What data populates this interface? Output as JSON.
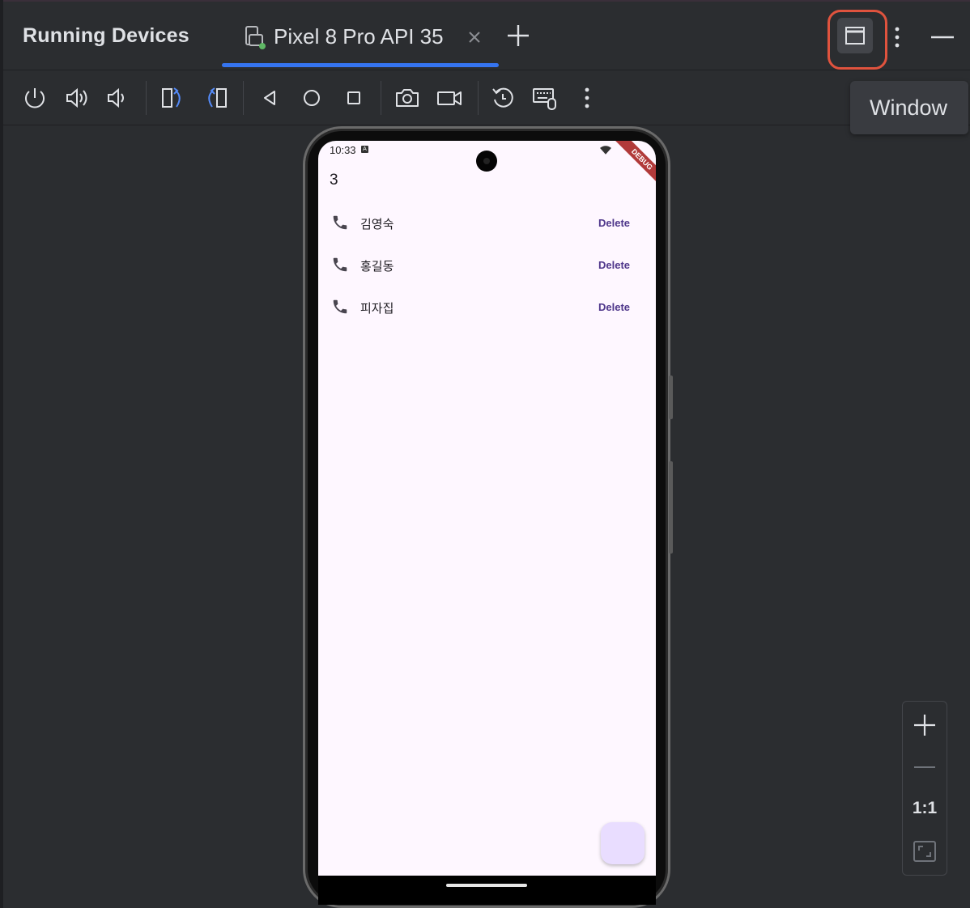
{
  "header": {
    "title": "Running Devices",
    "tab": {
      "label": "Pixel 8 Pro API 35"
    }
  },
  "tooltip": {
    "text": "Window"
  },
  "toolbar": {
    "icons": [
      "power-icon",
      "volume-up-icon",
      "volume-down-icon",
      "rotate-left-icon",
      "rotate-right-icon",
      "back-icon",
      "home-icon",
      "overview-icon",
      "screenshot-icon",
      "screen-record-icon",
      "reset-icon",
      "keyboard-mouse-icon",
      "more-icon"
    ]
  },
  "device": {
    "status_time": "10:33",
    "status_badge": "A",
    "debug_banner": "DEBUG",
    "counter": "3",
    "contacts": [
      {
        "name": "김영숙",
        "action": "Delete"
      },
      {
        "name": "홍길동",
        "action": "Delete"
      },
      {
        "name": "피자집",
        "action": "Delete"
      }
    ]
  },
  "zoom": {
    "reset_label": "1:1"
  },
  "colors": {
    "accent": "#3574f0",
    "highlight": "#e0533e",
    "background": "#2b2d30",
    "screen": "#fef7ff",
    "delete_text": "#4f378b",
    "fab": "#e9ddff"
  }
}
